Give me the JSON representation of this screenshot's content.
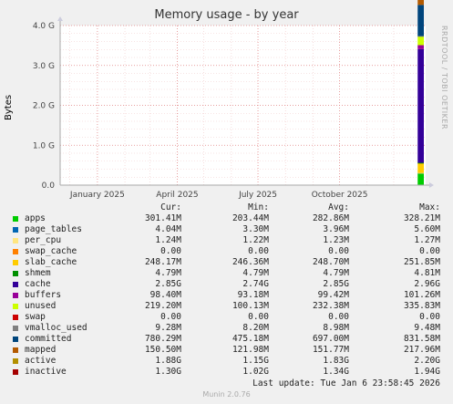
{
  "chart_data": {
    "type": "area",
    "title": "Memory usage - by year",
    "ylabel": "Bytes",
    "side_label": "RRDTOOL / TOBI OETIKER",
    "ylim": [
      0,
      4.0
    ],
    "y_ticks": [
      {
        "label": "0.0",
        "value": 0.0
      },
      {
        "label": "1.0 G",
        "value": 1.0
      },
      {
        "label": "2.0 G",
        "value": 2.0
      },
      {
        "label": "3.0 G",
        "value": 3.0
      },
      {
        "label": "4.0 G",
        "value": 4.0
      }
    ],
    "x_range": [
      "2024-11-20",
      "2026-01-06"
    ],
    "x_ticks": [
      {
        "label": "January 2025",
        "date": "2025-01-01"
      },
      {
        "label": "April 2025",
        "date": "2025-04-01"
      },
      {
        "label": "July 2025",
        "date": "2025-07-01"
      },
      {
        "label": "October 2025",
        "date": "2025-10-01"
      }
    ],
    "data_start": "2025-12-28",
    "grid": true,
    "columns": [
      "Cur:",
      "Min:",
      "Avg:",
      "Max:"
    ],
    "series": [
      {
        "name": "apps",
        "color": "#00cc00",
        "cur": "301.41M",
        "min": "203.44M",
        "avg": "282.86M",
        "max": "328.21M"
      },
      {
        "name": "page_tables",
        "color": "#0066b3",
        "cur": "4.04M",
        "min": "3.30M",
        "avg": "3.96M",
        "max": "5.60M"
      },
      {
        "name": "per_cpu",
        "color": "#ffe680",
        "cur": "1.24M",
        "min": "1.22M",
        "avg": "1.23M",
        "max": "1.27M"
      },
      {
        "name": "swap_cache",
        "color": "#ff8000",
        "cur": "0.00",
        "min": "0.00",
        "avg": "0.00",
        "max": "0.00"
      },
      {
        "name": "slab_cache",
        "color": "#ffcc00",
        "cur": "248.17M",
        "min": "246.36M",
        "avg": "248.70M",
        "max": "251.85M"
      },
      {
        "name": "shmem",
        "color": "#008f00",
        "cur": "4.79M",
        "min": "4.79M",
        "avg": "4.79M",
        "max": "4.81M"
      },
      {
        "name": "cache",
        "color": "#330099",
        "cur": "2.85G",
        "min": "2.74G",
        "avg": "2.85G",
        "max": "2.96G"
      },
      {
        "name": "buffers",
        "color": "#990099",
        "cur": "98.40M",
        "min": "93.18M",
        "avg": "99.42M",
        "max": "101.26M"
      },
      {
        "name": "unused",
        "color": "#ccff00",
        "cur": "219.20M",
        "min": "100.13M",
        "avg": "232.38M",
        "max": "335.83M"
      },
      {
        "name": "swap",
        "color": "#cc0000",
        "cur": "0.00",
        "min": "0.00",
        "avg": "0.00",
        "max": "0.00"
      },
      {
        "name": "vmalloc_used",
        "color": "#808080",
        "cur": "9.28M",
        "min": "8.20M",
        "avg": "8.98M",
        "max": "9.48M"
      },
      {
        "name": "committed",
        "color": "#00457c",
        "cur": "780.29M",
        "min": "475.18M",
        "avg": "697.00M",
        "max": "831.58M"
      },
      {
        "name": "mapped",
        "color": "#b35a00",
        "cur": "150.50M",
        "min": "121.98M",
        "avg": "151.77M",
        "max": "217.96M"
      },
      {
        "name": "active",
        "color": "#b38f00",
        "cur": "1.88G",
        "min": "1.15G",
        "avg": "1.83G",
        "max": "2.20G"
      },
      {
        "name": "inactive",
        "color": "#a50000",
        "cur": "1.30G",
        "min": "1.02G",
        "avg": "1.34G",
        "max": "1.94G"
      }
    ]
  },
  "last_update": "Last update: Tue Jan  6 23:58:45 2026",
  "footer": "Munin 2.0.76"
}
